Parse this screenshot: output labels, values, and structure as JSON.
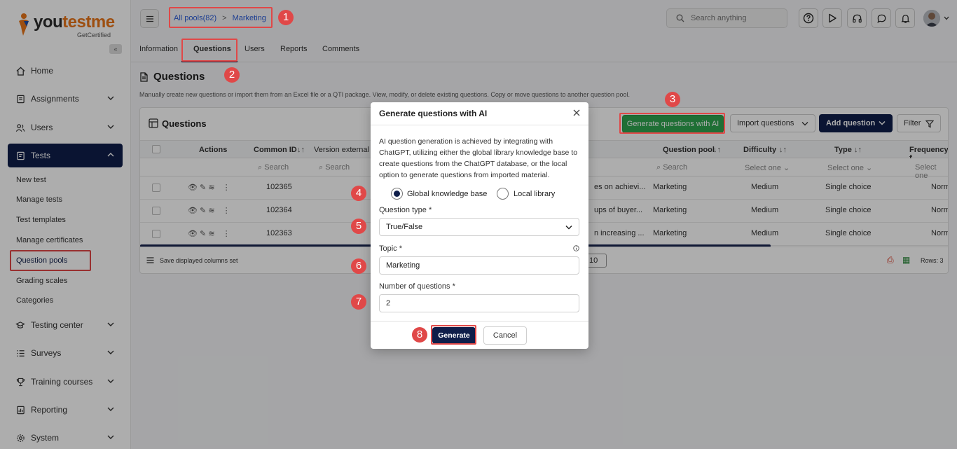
{
  "brand": {
    "logo_main_a": "you",
    "logo_main_b": "testme",
    "logo_sub": "GetCertified",
    "brand_color": "#e8751a"
  },
  "sidebar": {
    "collapse_label": "«",
    "items": [
      {
        "label": "Home",
        "icon": "home-icon"
      },
      {
        "label": "Assignments",
        "icon": "assignments-icon"
      },
      {
        "label": "Users",
        "icon": "users-icon"
      },
      {
        "label": "Tests",
        "icon": "tests-icon"
      },
      {
        "label": "Testing center",
        "icon": "testing-center-icon"
      },
      {
        "label": "Surveys",
        "icon": "surveys-icon"
      },
      {
        "label": "Training courses",
        "icon": "training-courses-icon"
      },
      {
        "label": "Reporting",
        "icon": "reporting-icon"
      },
      {
        "label": "System",
        "icon": "system-icon"
      }
    ],
    "tests_sub": [
      "New test",
      "Manage tests",
      "Test templates",
      "Manage certificates",
      "Question pools",
      "Grading scales",
      "Categories"
    ]
  },
  "topbar": {
    "breadcrumb_root": "All pools(82)",
    "breadcrumb_sep": ">",
    "breadcrumb_current": "Marketing",
    "search_placeholder": "Search anything"
  },
  "tabs": [
    "Information",
    "Questions",
    "Users",
    "Reports",
    "Comments"
  ],
  "page": {
    "title": "Questions",
    "description": "Manually create new questions or import them from an Excel file or a QTI package. View, modify, or delete existing questions. Copy or move questions to another question pool."
  },
  "grid": {
    "title": "Questions",
    "buttons": {
      "generate_ai": "Generate questions with AI",
      "import": "Import questions",
      "add": "Add question",
      "filter": "Filter"
    },
    "columns": {
      "actions": "Actions",
      "common_id": "Common ID",
      "version": "Version external",
      "pool": "Question pool",
      "difficulty": "Difficulty",
      "type": "Type",
      "frequency": "Frequency f"
    },
    "filters": {
      "search": "Search",
      "select": "Select one"
    },
    "rows": [
      {
        "id": "102365",
        "text": "es on achievi...",
        "pool": "Marketing",
        "difficulty": "Medium",
        "type": "Single choice",
        "freq": "Norm"
      },
      {
        "id": "102364",
        "text": "ups of buyer...",
        "pool": "Marketing",
        "difficulty": "Medium",
        "type": "Single choice",
        "freq": "Norm"
      },
      {
        "id": "102363",
        "text": "n increasing ...",
        "pool": "Marketing",
        "difficulty": "Medium",
        "type": "Single choice",
        "freq": "Norm"
      }
    ],
    "footer": {
      "save_columns": "Save displayed columns set",
      "page_size": "10",
      "rows_label": "Rows: 3"
    }
  },
  "modal": {
    "title": "Generate questions with AI",
    "description": "AI question generation is achieved by integrating with ChatGPT, utilizing either the global library knowledge base to create questions from the ChatGPT database, or the local option to generate questions from imported material.",
    "option_global": "Global knowledge base",
    "option_local": "Local library",
    "question_type_label": "Question type",
    "question_type_value": "True/False",
    "topic_label": "Topic",
    "topic_value": "Marketing",
    "number_label": "Number of questions",
    "number_value": "2",
    "required_mark": "*",
    "generate": "Generate",
    "cancel": "Cancel"
  },
  "annotations": [
    "1",
    "2",
    "3",
    "4",
    "5",
    "6",
    "7",
    "8"
  ],
  "colors": {
    "navy": "#0f1e4a",
    "green": "#2ea44f",
    "annotation_red": "#e04848",
    "link_blue": "#2a5bd7"
  }
}
